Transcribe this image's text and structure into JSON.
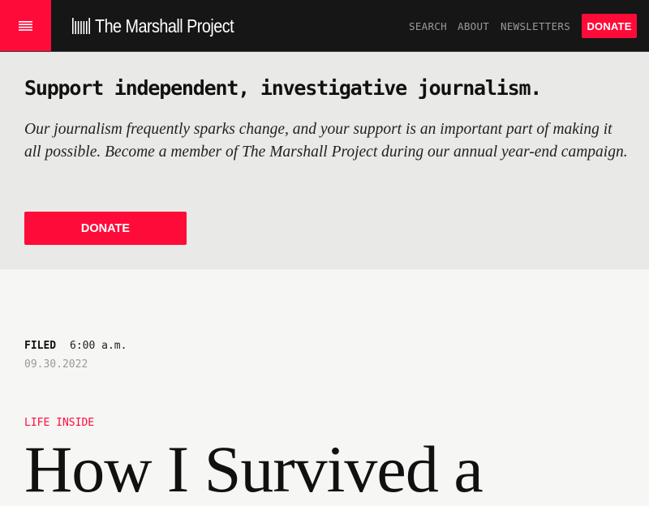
{
  "header": {
    "menu_icon": "hamburger-icon",
    "logo_icon": "bars-logo-icon",
    "logo_text": "The Marshall Project",
    "nav": {
      "search": "SEARCH",
      "about": "ABOUT",
      "newsletters": "NEWSLETTERS",
      "donate": "DONATE"
    }
  },
  "promo": {
    "title": "Support independent, investigative journalism.",
    "body": "Our journalism frequently sparks change, and your support is an important part of making it all possible. Become a member of The Marshall Project during our annual year-end campaign.",
    "donate": "DONATE"
  },
  "article": {
    "filed_label": "FILED",
    "filed_time": "6:00 a.m.",
    "filed_date": "09.30.2022",
    "section": "LIFE INSIDE",
    "headline": "How I Survived a"
  },
  "colors": {
    "accent": "#ff0b3a",
    "header_bg": "#161616",
    "promo_bg": "#e9e9e7",
    "page_bg": "#f6f6f4"
  }
}
